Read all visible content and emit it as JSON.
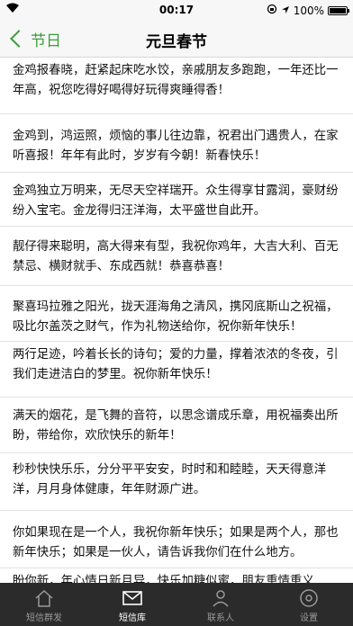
{
  "status_bar": {
    "carrier_icon": "wifi-icon",
    "time": "00:17",
    "battery_percent": "100%"
  },
  "nav": {
    "back_label": "节日",
    "title": "元旦春节"
  },
  "messages": [
    "金鸡报春晓，赶紧起床吃水饺，亲戚朋友多跑跑，一年还比一年高，祝您吃得好喝得好玩得爽睡得香！",
    "金鸡到，鸿运照，烦恼的事儿往边靠，祝君出门遇贵人，在家听喜报！年年有此时，岁岁有今朝！新春快乐！",
    "金鸡独立万明来，无尽天空祥瑞开。众生得享甘露润，豪财纷纷入宝宅。金龙得归汪洋海，太平盛世自此开。",
    "靓仔得来聪明，高大得来有型，我祝你鸡年，大吉大利、百无禁忌、横财就手、东成西就！恭喜恭喜！",
    "聚喜玛拉雅之阳光，拢天涯海角之清风，携冈底斯山之祝福，吸比尔盖茨之财气，作为礼物送给你，祝你新年快乐！",
    "两行足迹，吟着长长的诗句；爱的力量，撑着浓浓的冬夜，引我们走进洁白的梦里。祝你新年快乐！",
    "满天的烟花，是飞舞的音符，以思念谱成乐章，用祝福奏出所盼，带给你，欢欣快乐的新年！",
    "秒秒快快乐乐，分分平平安安，时时和和睦睦，天天得意洋洋，月月身体健康，年年财源广进。",
    "你如果现在是一个人，我祝你新年快乐；如果是两个人，那也新年快乐；如果是一伙人，请告诉我你们在什么地方。",
    "盼你新，年心情日新月异，快乐加糖似蜜，朋友重情重义"
  ],
  "tabs": [
    {
      "label": "短信群发",
      "icon": "home-icon"
    },
    {
      "label": "短信库",
      "icon": "envelope-icon"
    },
    {
      "label": "联系人",
      "icon": "contact-icon"
    },
    {
      "label": "设置",
      "icon": "settings-icon"
    }
  ],
  "colors": {
    "accent": "#3a9e3a",
    "tab_bar_bg": "#2b2b2b",
    "nav_bg": "#f7f7f7"
  }
}
